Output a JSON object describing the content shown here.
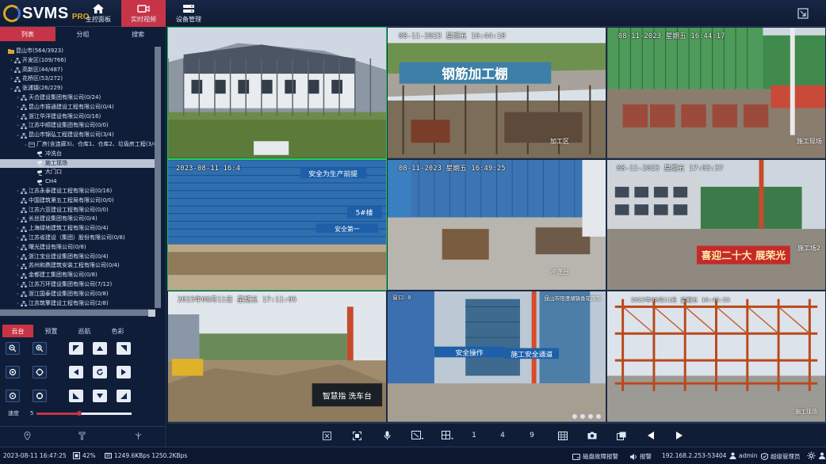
{
  "app": {
    "logo_text": "SVMS",
    "logo_badge": "PRO"
  },
  "nav": [
    {
      "label": "主控面板",
      "icon": "home-icon"
    },
    {
      "label": "实时视频",
      "icon": "video-camera-icon",
      "active": true
    },
    {
      "label": "设备管理",
      "icon": "device-icon"
    }
  ],
  "left_tabs": [
    {
      "label": "列表",
      "active": true
    },
    {
      "label": "分组"
    },
    {
      "label": "搜索"
    }
  ],
  "tree": [
    {
      "label": "昆山市(564/3923)",
      "level": 0,
      "arrow": "",
      "icon": "folder"
    },
    {
      "label": "开发区(109/766)",
      "level": 1,
      "arrow": "›",
      "icon": "org"
    },
    {
      "label": "高新区(44/487)",
      "level": 1,
      "arrow": "›",
      "icon": "org"
    },
    {
      "label": "花桥区(53/272)",
      "level": 1,
      "arrow": "›",
      "icon": "org"
    },
    {
      "label": "张浦镇(26/229)",
      "level": 1,
      "arrow": "⌄",
      "icon": "org"
    },
    {
      "label": "天合建设集团有限公司(0/24)",
      "level": 2,
      "arrow": "›",
      "icon": "org"
    },
    {
      "label": "昆山市振通建设工程有限公司(0/4)",
      "level": 2,
      "arrow": "›",
      "icon": "org"
    },
    {
      "label": "浙江华洋建设有限公司(0/16)",
      "level": 2,
      "arrow": "›",
      "icon": "org"
    },
    {
      "label": "江苏中顺建设集团有限公司(0/0)",
      "level": 2,
      "arrow": "›",
      "icon": "org"
    },
    {
      "label": "昆山市锦弘工程建设有限公司(3/4)",
      "level": 2,
      "arrow": "⌄",
      "icon": "org"
    },
    {
      "label": "厂房(含连廊3)、仓库1、仓库2、垃圾房工程(3/4)",
      "level": 3,
      "arrow": "⌄",
      "icon": "site"
    },
    {
      "label": "冲洗台",
      "level": 4,
      "arrow": "",
      "icon": "cam"
    },
    {
      "label": "施工现场",
      "level": 4,
      "arrow": "",
      "icon": "cam",
      "selected": true
    },
    {
      "label": "大门口",
      "level": 4,
      "arrow": "",
      "icon": "cam"
    },
    {
      "label": "CH4",
      "level": 4,
      "arrow": "",
      "icon": "cam"
    },
    {
      "label": "江苏永泰建设工程有限公司(0/16)",
      "level": 2,
      "arrow": "›",
      "icon": "org"
    },
    {
      "label": "中国建筑第五工程局有限公司(0/0)",
      "level": 2,
      "arrow": "",
      "icon": "org"
    },
    {
      "label": "江苏六亚建设工程有限公司(0/0)",
      "level": 2,
      "arrow": "",
      "icon": "org"
    },
    {
      "label": "长丝建设集团有限公司(0/4)",
      "level": 2,
      "arrow": "›",
      "icon": "org"
    },
    {
      "label": "上海绿地建筑工程有限公司(0/4)",
      "level": 2,
      "arrow": "›",
      "icon": "org"
    },
    {
      "label": "江苏省建设（集团）股份有限公司(0/8)",
      "level": 2,
      "arrow": "›",
      "icon": "org"
    },
    {
      "label": "曙光建设有限公司(0/8)",
      "level": 2,
      "arrow": "›",
      "icon": "org"
    },
    {
      "label": "浙江宝业建设集团有限公司(0/4)",
      "level": 2,
      "arrow": "›",
      "icon": "org"
    },
    {
      "label": "苏州和鼎建筑安装工程有限公司(0/4)",
      "level": 2,
      "arrow": "›",
      "icon": "org"
    },
    {
      "label": "金都建工集团有限公司(0/8)",
      "level": 2,
      "arrow": "›",
      "icon": "org"
    },
    {
      "label": "江苏万环建设集团有限公司(7/12)",
      "level": 2,
      "arrow": "›",
      "icon": "org"
    },
    {
      "label": "浙江国泰建设集团有限公司(0/8)",
      "level": 2,
      "arrow": "›",
      "icon": "org"
    },
    {
      "label": "江苏筑擎建设工程有限公司(2/8)",
      "level": 2,
      "arrow": "›",
      "icon": "org"
    }
  ],
  "ptz_tabs": [
    {
      "label": "云台",
      "active": true
    },
    {
      "label": "预置"
    },
    {
      "label": "巡航"
    },
    {
      "label": "色彩"
    }
  ],
  "ptz": {
    "speed_label": "速度",
    "speed_value": "5",
    "speed_fraction": 0.45
  },
  "cameras": [
    {
      "osd": "",
      "loc": "",
      "active": true,
      "scene": "house"
    },
    {
      "osd": "08-11-2023 星期五 16:44:18",
      "loc": "加工区",
      "scene": "rebar"
    },
    {
      "osd": "08-11-2023 星期五 16:44:17",
      "loc": "施工现场",
      "scene": "scaffold"
    },
    {
      "osd": "2023-08-11 16:4",
      "loc": "",
      "active": true,
      "scene": "wall"
    },
    {
      "osd": "08-11-2023 星期五 16:49:25",
      "loc": "冲洗台",
      "scene": "fence"
    },
    {
      "osd": "08-11-2023 星期五 17:03:37",
      "loc": "施工场2",
      "scene": "site2"
    },
    {
      "osd": "2023年08月11日 星期五 17:11:05",
      "loc": "",
      "scene": "excavator"
    },
    {
      "osd": "窗口 8",
      "loc": "昆山市阳澄湖镇香花路东",
      "scene": "tower"
    },
    {
      "osd": "2023年08月11日 星期五 16:46:53",
      "loc": "施工现场",
      "scene": "steel"
    }
  ],
  "banners": {
    "rebar_shed": "钢筋加工棚",
    "wash_sign": "智慧指 洗车台",
    "safety_wall": "安全为生产前提",
    "safety_wall2": "安全第一",
    "building_5": "5#楼",
    "party": "喜迎二十大 展荣光",
    "safety_channel": "施工安全通道",
    "tower_sign": "安全操作"
  },
  "controls": {
    "split1": "1",
    "split4": "4",
    "split9": "9"
  },
  "status": {
    "datetime": "2023-08-11 16:47:25",
    "cpu": "42%",
    "bandwidth": "1249.6KBps 1250.2KBps",
    "disk_alarm": "磁盘故障报警",
    "alarm": "报警",
    "ip": "192.168.2.253-53404",
    "user": "admin",
    "role": "超级管理员"
  },
  "colors": {
    "accent": "#c73447",
    "active_border": "#1fd05f",
    "panel": "#0f1d38"
  }
}
